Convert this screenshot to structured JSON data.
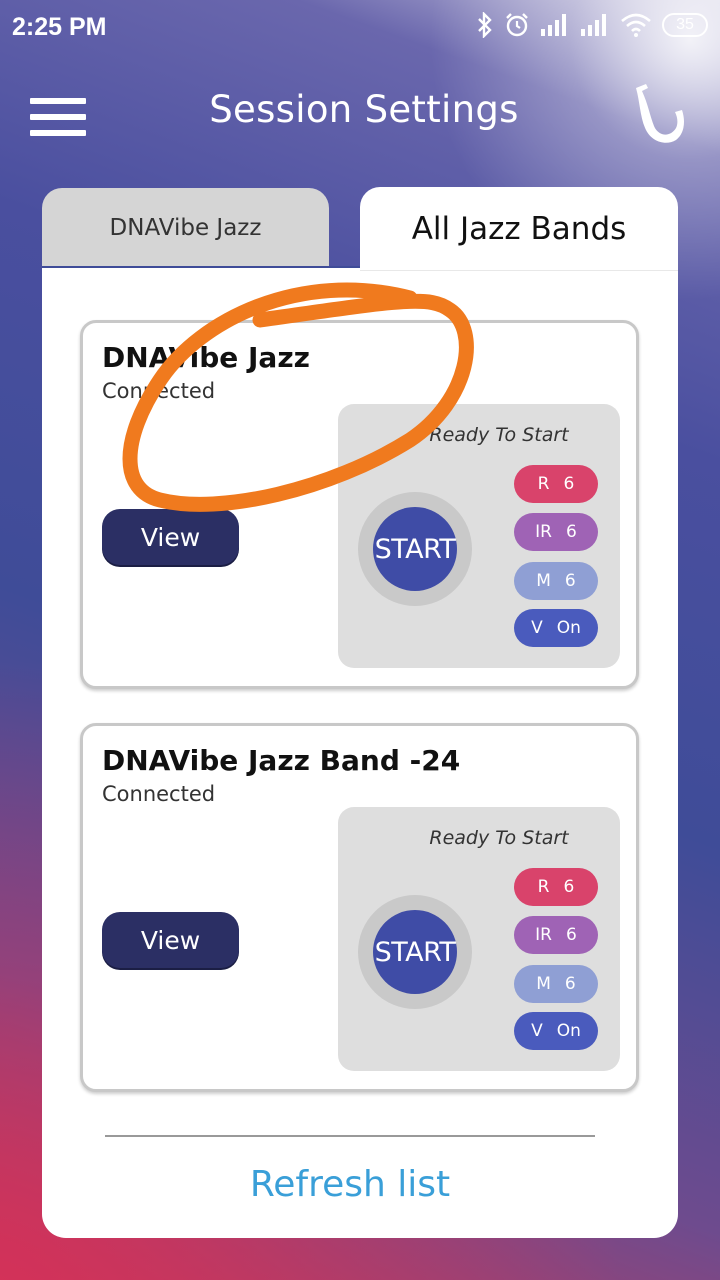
{
  "status_bar": {
    "time": "2:25 PM",
    "battery": "35",
    "icons": [
      "bluetooth-icon",
      "alarm-icon",
      "signal-icon",
      "signal-icon",
      "wifi-icon",
      "battery-icon"
    ]
  },
  "app_bar": {
    "title": "Session Settings",
    "menu_icon": "hamburger-menu-icon",
    "logo_icon": "saxophone-icon"
  },
  "tabs": [
    {
      "label": "DNAVibe Jazz",
      "active": false
    },
    {
      "label": "All Jazz Bands",
      "active": true
    }
  ],
  "devices": [
    {
      "name": "DNAVibe Jazz",
      "status": "Connected",
      "view_label": "View",
      "ready_text": "Ready To Start",
      "start_label": "START",
      "indicators": [
        {
          "key": "R",
          "value": "6",
          "color": "#d9436b"
        },
        {
          "key": "IR",
          "value": "6",
          "color": "#9f63b5"
        },
        {
          "key": "M",
          "value": "6",
          "color": "#8f9fd4"
        },
        {
          "key": "V",
          "value": "On",
          "color": "#4a5bbd"
        }
      ]
    },
    {
      "name": "DNAVibe Jazz Band -24",
      "status": "Connected",
      "view_label": "View",
      "ready_text": "Ready To Start",
      "start_label": "START",
      "indicators": [
        {
          "key": "R",
          "value": "6",
          "color": "#d9436b"
        },
        {
          "key": "IR",
          "value": "6",
          "color": "#9f63b5"
        },
        {
          "key": "M",
          "value": "6",
          "color": "#8f9fd4"
        },
        {
          "key": "V",
          "value": "On",
          "color": "#4a5bbd"
        }
      ]
    }
  ],
  "refresh_label": "Refresh list",
  "colors": {
    "accent_dark": "#2b2f64",
    "start_blue": "#3f4ca6",
    "refresh_blue": "#3a9fd8",
    "annotation_orange": "#f07a1e"
  }
}
